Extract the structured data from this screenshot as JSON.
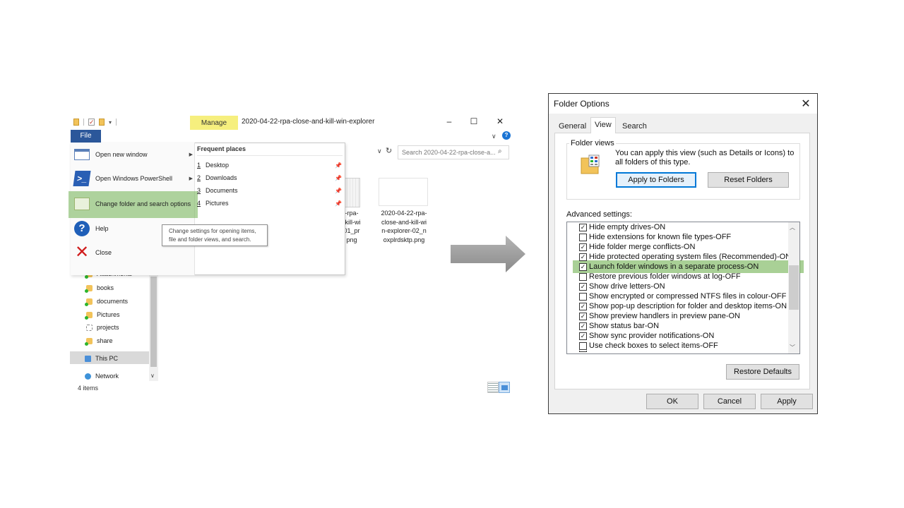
{
  "explorer": {
    "window_title": "2020-04-22-rpa-close-and-kill-win-explorer",
    "manage_tab": "Manage",
    "file_tab": "File",
    "search_placeholder": "Search 2020-04-22-rpa-close-a...",
    "status_items": "4 items",
    "file_menu": {
      "items": [
        {
          "label": "Open new window",
          "icon": "new-window-icon",
          "submenu": true
        },
        {
          "label": "Open Windows PowerShell",
          "icon": "powershell-icon",
          "submenu": true
        },
        {
          "label": "Change folder and search options",
          "icon": "folder-options-icon",
          "submenu": false,
          "highlighted": true
        },
        {
          "label": "Help",
          "icon": "help-icon",
          "submenu": false
        },
        {
          "label": "Close",
          "icon": "close-x-icon",
          "submenu": false
        }
      ],
      "frequent_places_title": "Frequent places",
      "frequent_places": [
        {
          "num": "1",
          "label": "Desktop"
        },
        {
          "num": "2",
          "label": "Downloads"
        },
        {
          "num": "3",
          "label": "Documents"
        },
        {
          "num": "4",
          "label": "Pictures"
        }
      ],
      "tooltip": "Change settings for opening items, file and folder views, and search."
    },
    "files": [
      {
        "label_lines": [
          "-rpa-",
          "-kill-wi",
          "01_pr",
          "png"
        ]
      },
      {
        "label_lines": [
          "2020-04-22-rpa-",
          "close-and-kill-wi",
          "n-explorer-02_n",
          "oxplrdsktp.png"
        ]
      }
    ],
    "nav": [
      {
        "label": "Attachments",
        "icon": "folder-icon"
      },
      {
        "label": "books",
        "icon": "folder-icon"
      },
      {
        "label": "documents",
        "icon": "folder-icon"
      },
      {
        "label": "Pictures",
        "icon": "folder-icon"
      },
      {
        "label": "projects",
        "icon": "shortcut-icon"
      },
      {
        "label": "share",
        "icon": "folder-icon"
      },
      {
        "label": "This PC",
        "icon": "computer-icon",
        "selected": true
      },
      {
        "label": "Network",
        "icon": "network-icon"
      }
    ]
  },
  "folder_options": {
    "title": "Folder Options",
    "tabs": [
      "General",
      "View",
      "Search"
    ],
    "active_tab": "View",
    "folder_views_label": "Folder views",
    "folder_views_text": "You can apply this view (such as Details or Icons) to all folders of this type.",
    "apply_to_folders": "Apply to Folders",
    "reset_folders": "Reset Folders",
    "advanced_label": "Advanced settings:",
    "advanced_items": [
      {
        "label": "Hide empty drives-ON",
        "checked": true
      },
      {
        "label": "Hide extensions for known file types-OFF",
        "checked": false
      },
      {
        "label": "Hide folder merge conflicts-ON",
        "checked": true
      },
      {
        "label": "Hide protected operating system files (Recommended)-ON",
        "checked": true
      },
      {
        "label": "Launch folder windows in a separate process-ON",
        "checked": true,
        "highlighted": true
      },
      {
        "label": "Restore previous folder windows at log-OFF",
        "checked": false
      },
      {
        "label": "Show drive letters-ON",
        "checked": true
      },
      {
        "label": "Show encrypted or compressed NTFS files in colour-OFF",
        "checked": false
      },
      {
        "label": "Show pop-up description for folder and desktop items-ON",
        "checked": true
      },
      {
        "label": "Show preview handlers in preview pane-ON",
        "checked": true
      },
      {
        "label": "Show status bar-ON",
        "checked": true
      },
      {
        "label": "Show sync provider notifications-ON",
        "checked": true
      },
      {
        "label": "Use check boxes to select items-OFF",
        "checked": false
      }
    ],
    "restore_defaults": "Restore Defaults",
    "ok": "OK",
    "cancel": "Cancel",
    "apply": "Apply"
  },
  "colors": {
    "highlight_green": "#70b050",
    "manage_yellow": "#f6ef7e",
    "file_blue": "#2b579a",
    "arrow_gray": "#9b9b9b"
  }
}
